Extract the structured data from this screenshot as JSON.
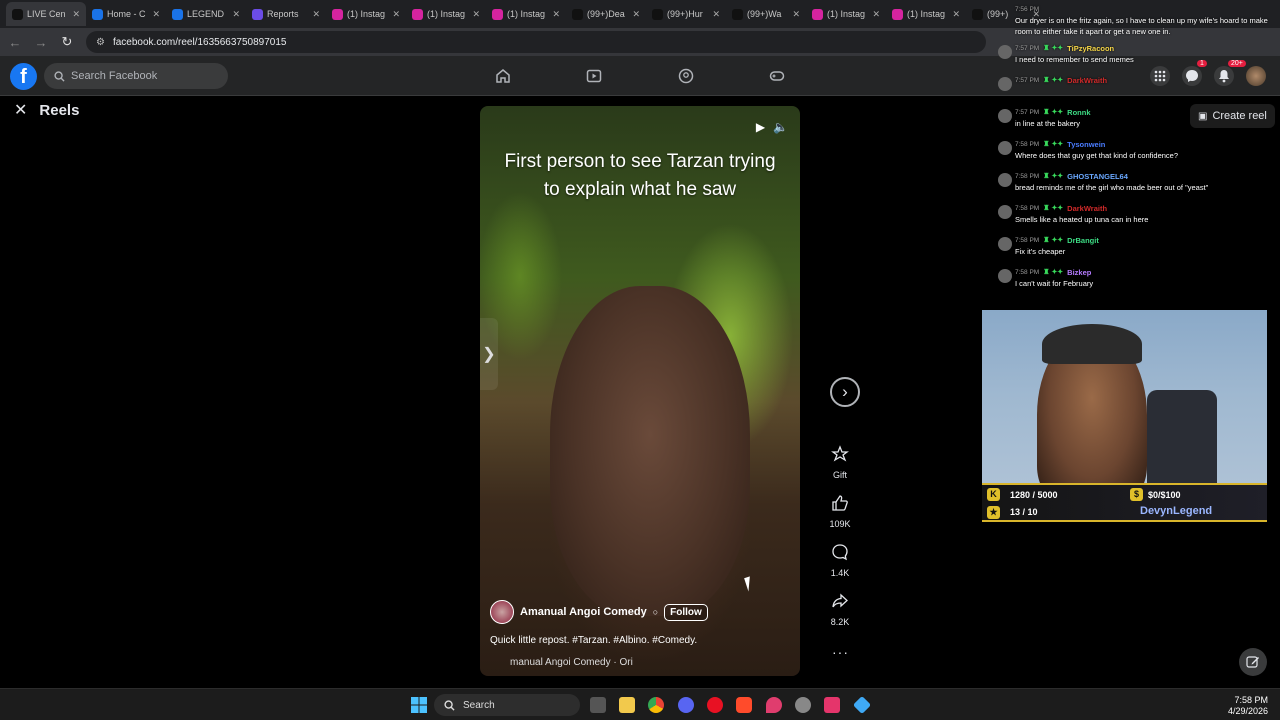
{
  "browser": {
    "tabs": [
      {
        "label": "LIVE Cen",
        "icon": "tiktok-icon",
        "color": "#111111"
      },
      {
        "label": "Home - C",
        "icon": "globe-icon",
        "color": "#1a73e8"
      },
      {
        "label": "LEGEND",
        "icon": "globe-icon",
        "color": "#1a73e8"
      },
      {
        "label": "Reports",
        "icon": "report-icon",
        "color": "#6b4ce6"
      },
      {
        "label": "(1) Instag",
        "icon": "instagram-icon",
        "color": "#d6249f"
      },
      {
        "label": "(1) Instag",
        "icon": "instagram-icon",
        "color": "#d6249f"
      },
      {
        "label": "(1) Instag",
        "icon": "instagram-icon",
        "color": "#d6249f"
      },
      {
        "label": "(99+)Dea",
        "icon": "tiktok-icon",
        "color": "#111111"
      },
      {
        "label": "(99+)Hur",
        "icon": "tiktok-icon",
        "color": "#111111"
      },
      {
        "label": "(99+)Wa",
        "icon": "tiktok-icon",
        "color": "#111111"
      },
      {
        "label": "(1) Instag",
        "icon": "instagram-icon",
        "color": "#d6249f"
      },
      {
        "label": "(1) Instag",
        "icon": "instagram-icon",
        "color": "#d6249f"
      },
      {
        "label": "(99+)",
        "icon": "tiktok-icon",
        "color": "#111111"
      }
    ],
    "url": "facebook.com/reel/1635663750897015"
  },
  "facebook": {
    "search_placeholder": "Search Facebook",
    "notification_badge": "1",
    "notification_badge_2": "20+",
    "reels_title": "Reels",
    "create_reel_label": "Create reel"
  },
  "reel": {
    "overlay_text": "First person to see Tarzan trying to explain what he saw",
    "author": "Amanual Angoi Comedy",
    "follow_label": "Follow",
    "caption": "Quick little repost. #Tarzan. #Albino. #Comedy.",
    "audio": "manual Angoi Comedy · Ori",
    "actions": {
      "gift_label": "Gift",
      "likes": "109K",
      "comments": "1.4K",
      "shares": "8.2K"
    }
  },
  "chat": {
    "top_message": "Our dryer is on the fritz again, so I have to clean up my wife's hoard to make room to either take it apart or get a new one in.",
    "top_time": "7:56 PM",
    "messages": [
      {
        "time": "7:57 PM",
        "user": "TiPzyRacoon",
        "color": "#f5d547",
        "text": "I need to remember to send memes"
      },
      {
        "time": "7:57 PM",
        "user": "DarkWraith",
        "color": "#d12a2a",
        "text": ""
      },
      {
        "time": "7:57 PM",
        "user": "Ronnk",
        "color": "#3ddc84",
        "text": "in line at the bakery"
      },
      {
        "time": "7:58 PM",
        "user": "Tysonwein",
        "color": "#4a7cff",
        "text": "Where does that guy get that kind of confidence?"
      },
      {
        "time": "7:58 PM",
        "user": "GHOSTANGEL64",
        "color": "#6aa8ff",
        "text": "bread reminds me of the girl who made beer out of \"yeast\""
      },
      {
        "time": "7:58 PM",
        "user": "DarkWraith",
        "color": "#d12a2a",
        "text": "Smells like a heated up tuna can in here"
      },
      {
        "time": "7:58 PM",
        "user": "DrBangit",
        "color": "#3ddc84",
        "text": "Fix it's cheaper"
      },
      {
        "time": "7:58 PM",
        "user": "Bizkep",
        "color": "#b57bff",
        "text": "I can't wait for February"
      }
    ]
  },
  "stream": {
    "goal_1": "1280 / 5000",
    "goal_2": "$0/$100",
    "goal_3": "13 / 10",
    "streamer": "DevynLegend"
  },
  "taskbar": {
    "search_label": "Search",
    "time": "7:58 PM",
    "date": "4/29/2026"
  }
}
